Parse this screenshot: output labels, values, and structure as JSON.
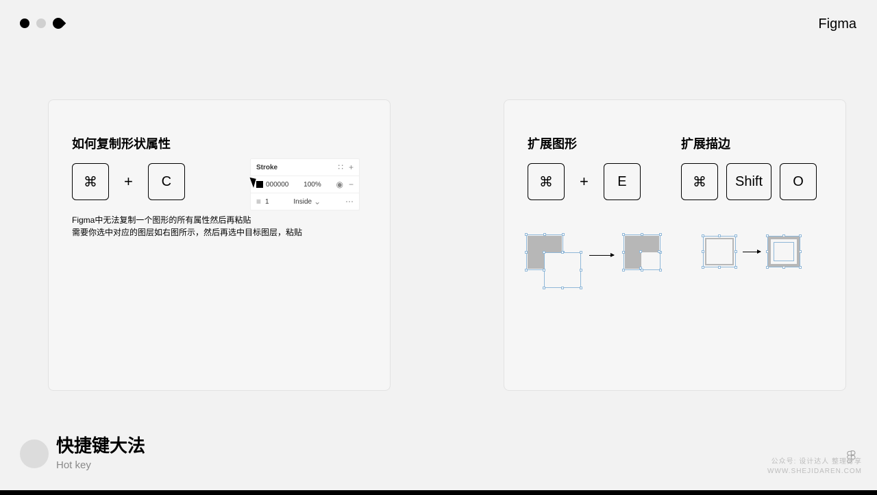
{
  "header": {
    "brand": "Figma"
  },
  "left_card": {
    "title": "如何复制形状属性",
    "keys": {
      "k1": "⌘",
      "k2": "C",
      "plus": "+"
    },
    "desc_line1": "Figma中无法复制一个图形的所有属性然后再粘贴",
    "desc_line2": "需要你选中对应的图层如右图所示，然后再选中目标图层，粘贴",
    "stroke_panel": {
      "title": "Stroke",
      "color_hex": "000000",
      "opacity": "100%",
      "weight": "1",
      "align": "Inside"
    }
  },
  "right_card": {
    "title_e": "扩展图形",
    "title_o": "扩展描边",
    "keys_e": {
      "k1": "⌘",
      "k2": "E",
      "plus": "+"
    },
    "keys_o": {
      "k1": "⌘",
      "k2": "Shift",
      "k3": "O"
    }
  },
  "footer": {
    "title": "快捷键大法",
    "subtitle": "Hot key"
  },
  "watermark": {
    "line1": "公众号: 设计达人 整理分享",
    "line2": "WWW.SHEJIDAREN.COM"
  }
}
